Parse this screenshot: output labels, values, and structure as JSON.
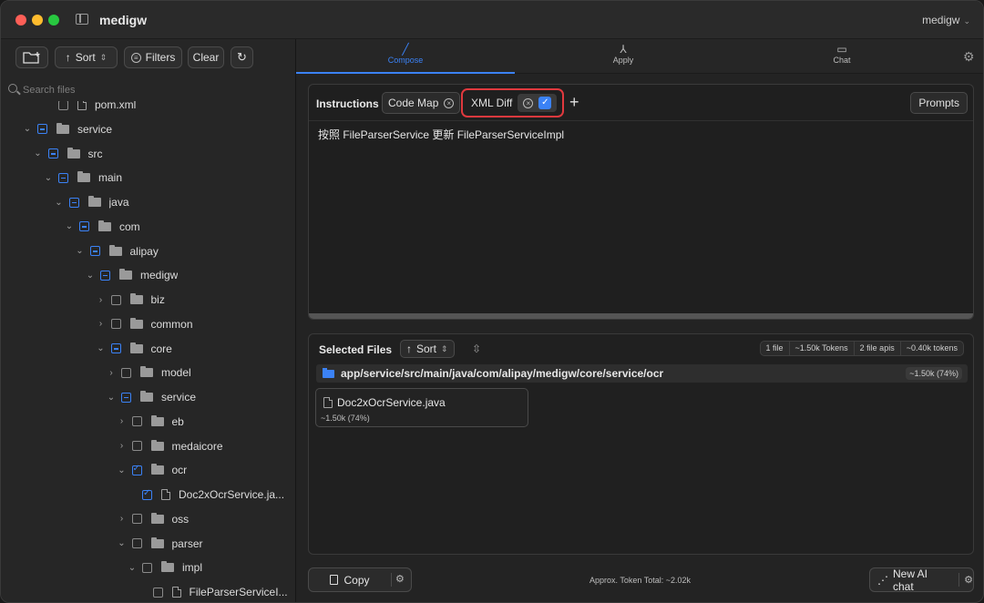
{
  "app": {
    "title": "medigw",
    "workspace": "medigw"
  },
  "toolbar": {
    "sort": "Sort",
    "filters": "Filters",
    "clear": "Clear"
  },
  "search": {
    "placeholder": "Search files"
  },
  "tree": [
    {
      "label": "pom.xml",
      "kind": "file",
      "depth": 3,
      "state": "none",
      "chevron": ""
    },
    {
      "label": "service",
      "kind": "folder",
      "depth": 1,
      "state": "partial",
      "chevron": "down"
    },
    {
      "label": "src",
      "kind": "folder",
      "depth": 2,
      "state": "partial",
      "chevron": "down"
    },
    {
      "label": "main",
      "kind": "folder",
      "depth": 3,
      "state": "partial",
      "chevron": "down"
    },
    {
      "label": "java",
      "kind": "folder",
      "depth": 4,
      "state": "partial",
      "chevron": "down"
    },
    {
      "label": "com",
      "kind": "folder",
      "depth": 5,
      "state": "partial",
      "chevron": "down"
    },
    {
      "label": "alipay",
      "kind": "folder",
      "depth": 6,
      "state": "partial",
      "chevron": "down"
    },
    {
      "label": "medigw",
      "kind": "folder",
      "depth": 7,
      "state": "partial",
      "chevron": "down"
    },
    {
      "label": "biz",
      "kind": "folder",
      "depth": 8,
      "state": "none",
      "chevron": "right"
    },
    {
      "label": "common",
      "kind": "folder",
      "depth": 8,
      "state": "none",
      "chevron": "right"
    },
    {
      "label": "core",
      "kind": "folder",
      "depth": 8,
      "state": "partial",
      "chevron": "down"
    },
    {
      "label": "model",
      "kind": "folder",
      "depth": 9,
      "state": "none",
      "chevron": "right"
    },
    {
      "label": "service",
      "kind": "folder",
      "depth": 9,
      "state": "partial",
      "chevron": "down"
    },
    {
      "label": "eb",
      "kind": "folder",
      "depth": 10,
      "state": "none",
      "chevron": "right"
    },
    {
      "label": "medaicore",
      "kind": "folder",
      "depth": 10,
      "state": "none",
      "chevron": "right"
    },
    {
      "label": "ocr",
      "kind": "folder",
      "depth": 10,
      "state": "checked",
      "chevron": "down"
    },
    {
      "label": "Doc2xOcrService.ja...",
      "kind": "file",
      "depth": 11,
      "state": "checked",
      "chevron": ""
    },
    {
      "label": "oss",
      "kind": "folder",
      "depth": 10,
      "state": "none",
      "chevron": "right"
    },
    {
      "label": "parser",
      "kind": "folder",
      "depth": 10,
      "state": "none",
      "chevron": "down"
    },
    {
      "label": "impl",
      "kind": "folder",
      "depth": 11,
      "state": "none",
      "chevron": "down"
    },
    {
      "label": "FileParserServiceI...",
      "kind": "file",
      "depth": 12,
      "state": "none",
      "chevron": ""
    }
  ],
  "tabs": [
    {
      "label": "Compose",
      "icon": "pen-icon",
      "active": true
    },
    {
      "label": "Apply",
      "icon": "merge-icon",
      "active": false
    },
    {
      "label": "Chat",
      "icon": "chat-bubbles-icon",
      "active": false
    }
  ],
  "instructions": {
    "title": "Instructions",
    "code_map": "Code Map",
    "xml_diff": "XML Diff",
    "xml_diff_checked": true,
    "prompts": "Prompts",
    "text": "按照 FileParserService 更新 FileParserServiceImpl"
  },
  "selected_files": {
    "title": "Selected Files",
    "sort": "Sort",
    "stats": [
      "1 file",
      "~1.50k Tokens",
      "2 file apis",
      "~0.40k tokens"
    ],
    "path": "app/service/src/main/java/com/alipay/medigw/core/service/ocr",
    "path_tokens": "~1.50k (74%)",
    "file_name": "Doc2xOcrService.java",
    "file_tokens": "~1.50k (74%)"
  },
  "footer": {
    "copy": "Copy",
    "token_total": "Approx. Token Total: ~2.02k",
    "new_chat": "New AI chat"
  },
  "colors": {
    "accent": "#3b82f6",
    "highlight": "#e0393e",
    "background": "#232323"
  }
}
